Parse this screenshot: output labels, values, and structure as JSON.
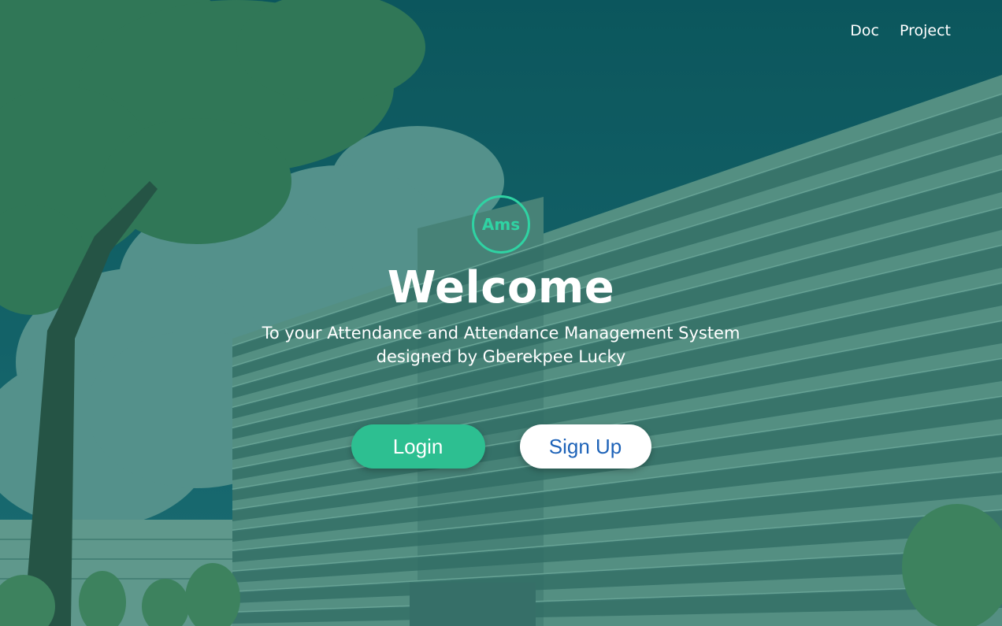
{
  "nav": {
    "items": [
      "Doc",
      "Project"
    ]
  },
  "hero": {
    "logo_text": "Ams",
    "title": "Welcome",
    "subtitle_line1": "To your Attendance and Attendance Management System",
    "subtitle_line2": "designed by Gberekpee Lucky"
  },
  "actions": {
    "login_label": "Login",
    "signup_label": "Sign Up"
  },
  "colors": {
    "accent": "#2fd3a3",
    "login_button": "#2dbf91",
    "signup_text": "#1e63b8"
  }
}
